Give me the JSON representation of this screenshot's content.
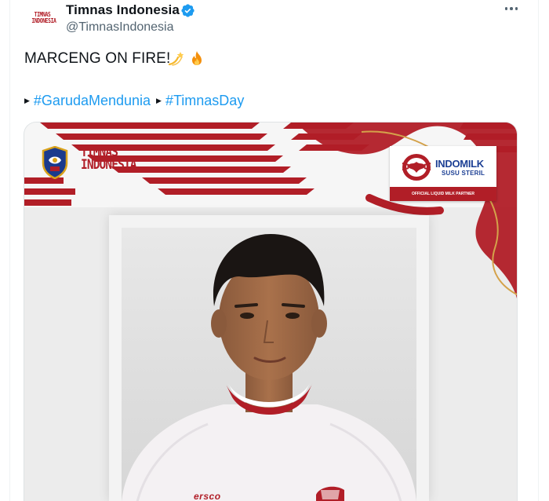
{
  "tweet": {
    "display_name": "Timnas Indonesia",
    "handle": "@TimnasIndonesia",
    "avatar_text": "TIMNAS INDONESIA",
    "text": "MARCENG ON FIRE!",
    "emojis": [
      "dizzy-emoji",
      "fire-emoji"
    ],
    "hashtags": [
      "#GarudaMendunia",
      "#TimnasDay"
    ]
  },
  "media": {
    "brand_wordmark_line1": "TIMNAS",
    "brand_wordmark_line2": "INDONESIA",
    "sponsor_name": "INDOMILK",
    "sponsor_sub": "SUSU STERIL",
    "sponsor_footer": "OFFICIAL LIQUID MILK PARTNER",
    "jersey_brand": "ersco"
  },
  "colors": {
    "accent": "#1d9bf0",
    "brand_red": "#b11e27",
    "text_secondary": "#536471"
  }
}
